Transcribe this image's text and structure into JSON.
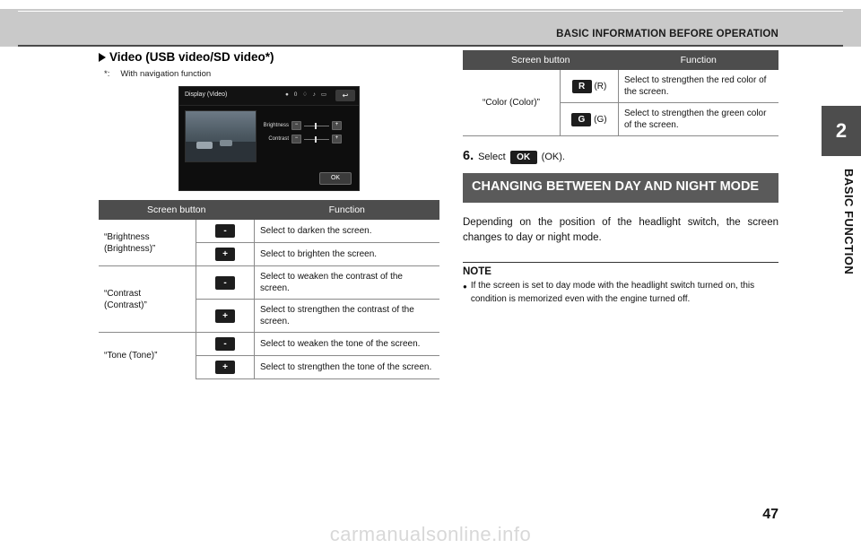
{
  "header": {
    "title": "BASIC INFORMATION BEFORE OPERATION",
    "chapter_number": "2",
    "chapter_name": "BASIC FUNCTION"
  },
  "left": {
    "heading": "Video (USB video/SD video*)",
    "footnote_mark": "*:",
    "footnote_text": "With navigation function",
    "device": {
      "title": "Display (Video)",
      "status_icons": "●  0 ♢ ♪ ▭",
      "back_label": "↩",
      "slider1_label": "Brightness",
      "slider2_label": "Contrast",
      "minus": "−",
      "plus": "+",
      "ok_label": "OK"
    },
    "table": {
      "col1": "Screen button",
      "col2": "Function",
      "rows": [
        {
          "label": "“Brightness\n(Brightness)”",
          "label_line1": "“Brightness",
          "label_line2": "(Brightness)”",
          "items": [
            {
              "button": "-",
              "function": "Select to darken the screen."
            },
            {
              "button": "+",
              "function": "Select to brighten the screen."
            }
          ]
        },
        {
          "label_line1": "“Contrast",
          "label_line2": "(Contrast)”",
          "items": [
            {
              "button": "-",
              "function": "Select to weaken the contrast of the screen."
            },
            {
              "button": "+",
              "function": "Select to strengthen the contrast of the screen."
            }
          ]
        },
        {
          "label_line1": "“Tone (Tone)”",
          "label_line2": "",
          "items": [
            {
              "button": "-",
              "function": "Select to weaken the tone of the screen."
            },
            {
              "button": "+",
              "function": "Select to strengthen the tone of the screen."
            }
          ]
        }
      ]
    }
  },
  "right": {
    "table": {
      "col1": "Screen button",
      "col2": "Function",
      "label": "“Color (Color)”",
      "rows": [
        {
          "key": "R",
          "key_suffix": "(R)",
          "function": "Select to strengthen the red color of the screen."
        },
        {
          "key": "G",
          "key_suffix": "(G)",
          "function": "Select to strengthen the green color of the screen."
        }
      ]
    },
    "step": {
      "number": "6.",
      "text_before": "Select",
      "key": "OK",
      "text_after": "(OK)."
    },
    "band_title": "CHANGING BETWEEN DAY AND NIGHT MODE",
    "paragraph": "Depending on the position of the headlight switch, the screen changes to day or night mode.",
    "note": {
      "title": "NOTE",
      "items": [
        "If the screen is set to day mode with the headlight switch turned on, this condition is memorized even with the engine turned off."
      ]
    }
  },
  "footer": {
    "page_number": "47",
    "watermark": "carmanualsonline.info"
  }
}
